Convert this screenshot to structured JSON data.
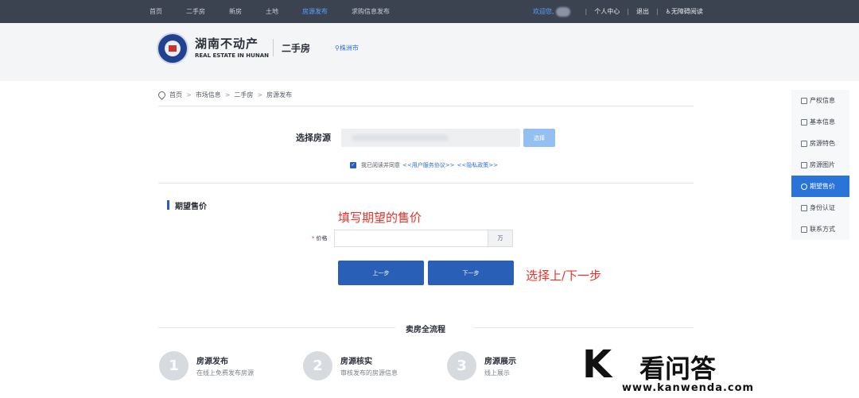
{
  "topnav": {
    "links": [
      "首页",
      "二手房",
      "新房",
      "土地",
      "房源发布",
      "求购信息发布"
    ],
    "active_index": 4,
    "welcome": "欢迎您,",
    "personal_center": "个人中心",
    "logout": "退出",
    "accessibility": "♿无障碍阅读"
  },
  "header": {
    "brand_cn": "湖南不动产",
    "brand_en": "REAL ESTATE IN HUNAN",
    "section_title": "二手房",
    "city": "株洲市"
  },
  "breadcrumb": [
    "首页",
    "市场信息",
    "二手房",
    "房源发布"
  ],
  "choose": {
    "label": "选择房源",
    "button": "选择"
  },
  "agreement": {
    "text": "我已阅读并同意",
    "link1": "<<用户服务协议>>",
    "link2": "<<隐私政策>>"
  },
  "section": {
    "title": "期望售价",
    "price_label": "价格",
    "price_required": "*",
    "price_value": "",
    "unit": "万"
  },
  "buttons": {
    "prev": "上一步",
    "next": "下一步"
  },
  "annotations": {
    "fill_price": "填写期望的售价",
    "choose_step": "选择上/下一步"
  },
  "flow": {
    "title": "卖房全流程",
    "steps": [
      {
        "num": "1",
        "title": "房源发布",
        "desc": "在线上免费发布房源"
      },
      {
        "num": "2",
        "title": "房源核实",
        "desc": "审核发布的房源信息"
      },
      {
        "num": "3",
        "title": "房源展示",
        "desc": "线上展示"
      }
    ]
  },
  "rail": [
    {
      "label": "产权信息",
      "icon": "document-icon"
    },
    {
      "label": "基本信息",
      "icon": "list-icon"
    },
    {
      "label": "房源特色",
      "icon": "home-icon"
    },
    {
      "label": "房源图片",
      "icon": "image-icon"
    },
    {
      "label": "期望售价",
      "icon": "money-icon"
    },
    {
      "label": "身份认证",
      "icon": "id-card-icon"
    },
    {
      "label": "联系方式",
      "icon": "phone-icon"
    }
  ],
  "rail_active_index": 4,
  "watermark": {
    "name": "看问答",
    "url": "www.kanwenda.com",
    "logo": "K"
  },
  "colors": {
    "nav_bg": "#3c4350",
    "primary": "#2a5fb8",
    "accent_red": "#e8322b",
    "link": "#2f6fd6"
  }
}
